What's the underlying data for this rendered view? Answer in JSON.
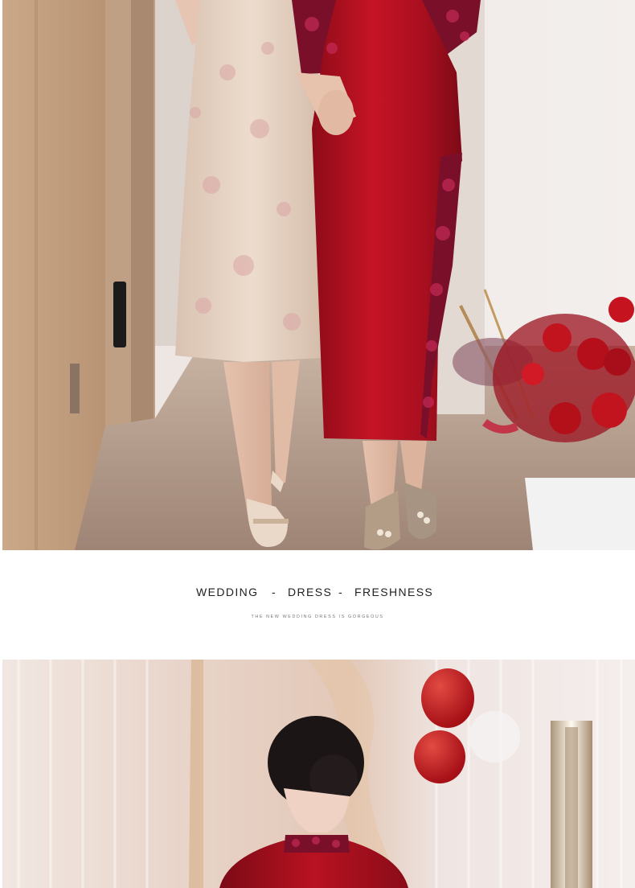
{
  "caption": {
    "word1": "WEDDING",
    "sep1": "-",
    "word2": "DRESS",
    "sep2": "-",
    "word3": "FRESHNESS",
    "subtitle": "THE NEW WEDDING DRESS IS GORGEOUS"
  },
  "colors": {
    "dress_red": "#b3101e",
    "lace_burgundy": "#7a0f2a",
    "champagne": "#e6d0c0",
    "wall": "#efe9e6",
    "wood_door": "#c9a98a",
    "balloon": "#c0151b"
  }
}
